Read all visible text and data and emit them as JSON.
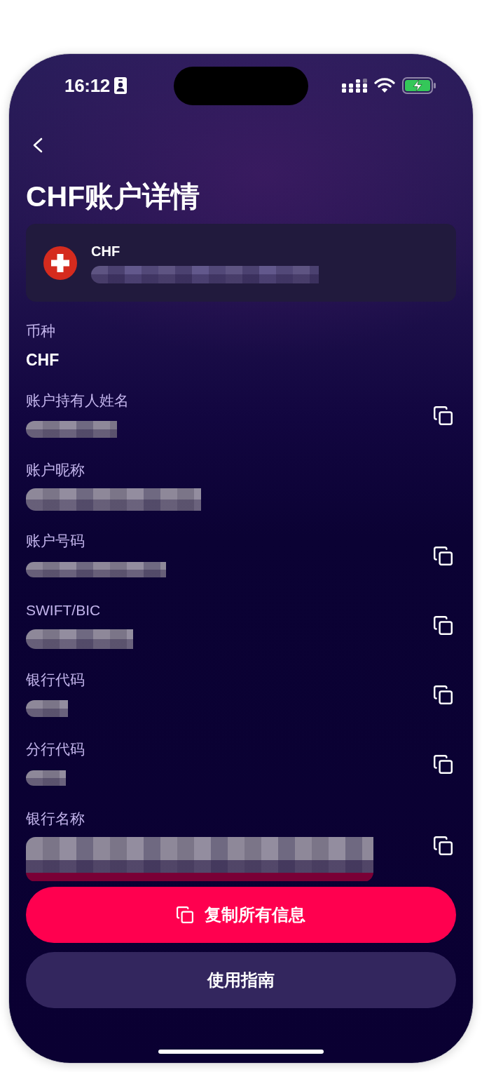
{
  "status_bar": {
    "time": "16:12"
  },
  "header": {
    "title": "CHF账户详情"
  },
  "account_card": {
    "currency": "CHF",
    "account_number": {
      "kind": "redacted"
    }
  },
  "fields": [
    {
      "label": "币种",
      "kind": "text",
      "value": "CHF",
      "copyable": false
    },
    {
      "label": "账户持有人姓名",
      "kind": "redacted",
      "copyable": true
    },
    {
      "label": "账户昵称",
      "kind": "redacted",
      "copyable": false
    },
    {
      "label": "账户号码",
      "kind": "redacted",
      "copyable": true
    },
    {
      "label": "SWIFT/BIC",
      "kind": "redacted",
      "copyable": true
    },
    {
      "label": "银行代码",
      "kind": "redacted",
      "copyable": true
    },
    {
      "label": "分行代码",
      "kind": "redacted",
      "copyable": true
    },
    {
      "label": "银行名称",
      "kind": "redacted",
      "copyable": true
    }
  ],
  "buttons": [
    {
      "label": "复制所有信息",
      "kind": "primary"
    },
    {
      "label": "使用指南",
      "kind": "secondary"
    }
  ]
}
